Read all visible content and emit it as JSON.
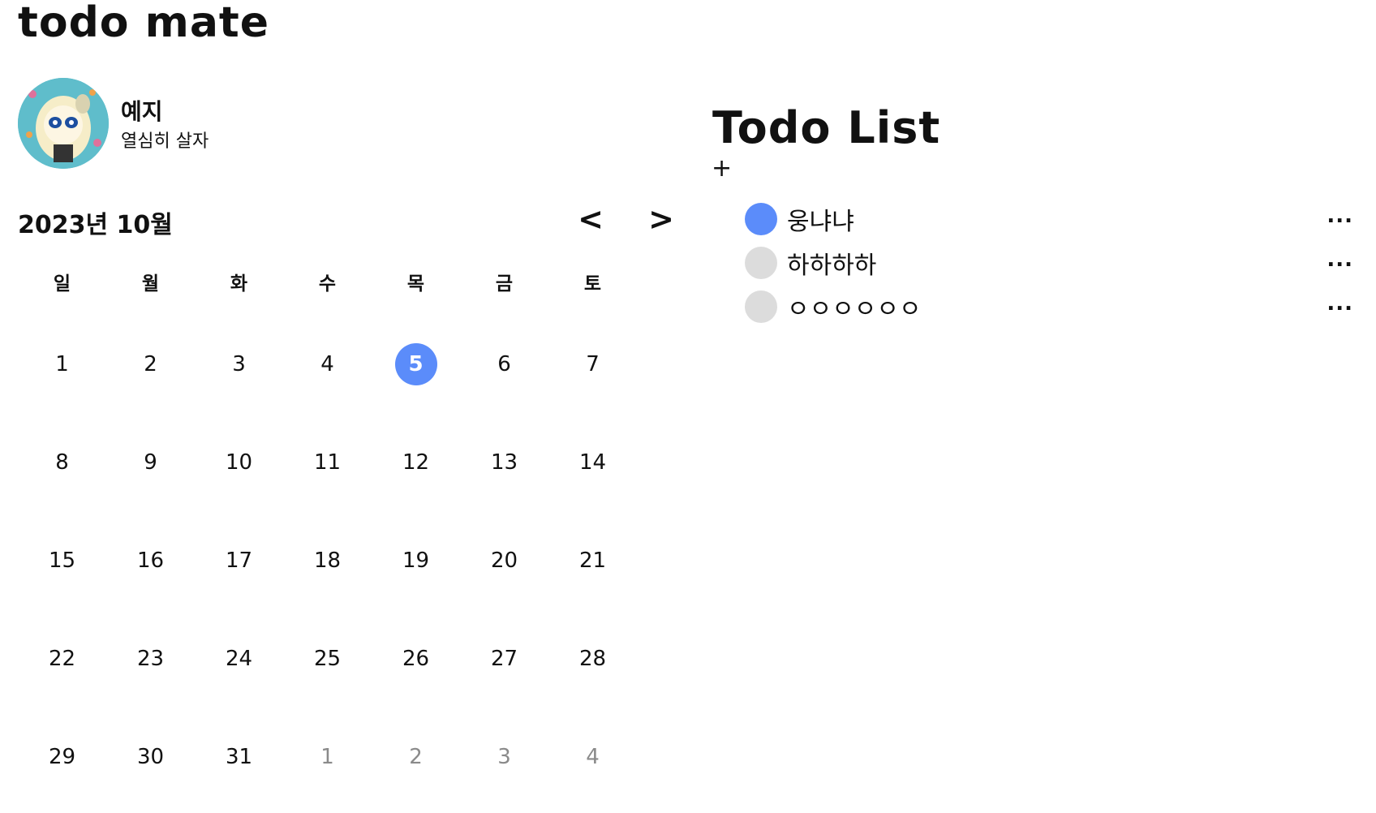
{
  "app": {
    "title": "todo mate"
  },
  "profile": {
    "name": "예지",
    "status": "열심히 살자"
  },
  "calendar": {
    "month_label": "2023년 10월",
    "prev_label": "<",
    "next_label": ">",
    "weekdays": [
      "일",
      "월",
      "화",
      "수",
      "목",
      "금",
      "토"
    ],
    "weeks": [
      [
        "1",
        "2",
        "3",
        "4",
        "5",
        "6",
        "7"
      ],
      [
        "8",
        "9",
        "10",
        "11",
        "12",
        "13",
        "14"
      ],
      [
        "15",
        "16",
        "17",
        "18",
        "19",
        "20",
        "21"
      ],
      [
        "22",
        "23",
        "24",
        "25",
        "26",
        "27",
        "28"
      ],
      [
        "29",
        "30",
        "31",
        "1",
        "2",
        "3",
        "4"
      ]
    ],
    "selected_day": "5",
    "accent_color": "#5b8cfa"
  },
  "todo": {
    "title": "Todo List",
    "add_label": "+",
    "items": [
      {
        "text": "웅냐냐",
        "done": true,
        "more_label": "..."
      },
      {
        "text": "하하하하",
        "done": false,
        "more_label": "..."
      },
      {
        "text": "ㅇㅇㅇㅇㅇㅇ",
        "done": false,
        "more_label": "..."
      }
    ]
  }
}
